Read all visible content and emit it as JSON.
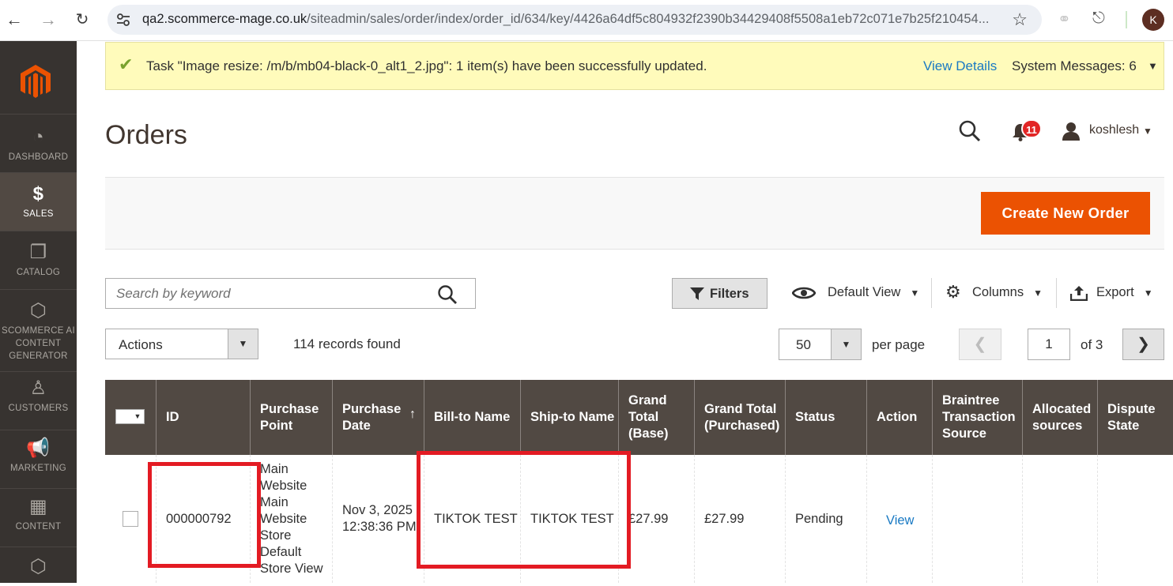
{
  "browser": {
    "url_host": "qa2.scommerce-mage.co.uk",
    "url_path": "/siteadmin/sales/order/index/order_id/634/key/4426a64df5c804932f2390b34429408f5508a1eb72c071e7b25f210454...",
    "profile_initial": "K"
  },
  "sidebar": {
    "items": [
      {
        "label": "DASHBOARD",
        "icon": "dashboard-icon"
      },
      {
        "label": "SALES",
        "icon": "dollar-icon"
      },
      {
        "label": "CATALOG",
        "icon": "box-icon"
      },
      {
        "label": "SCOMMERCE AI CONTENT GENERATOR",
        "icon": "hexagon-icon"
      },
      {
        "label": "CUSTOMERS",
        "icon": "person-icon"
      },
      {
        "label": "MARKETING",
        "icon": "megaphone-icon"
      },
      {
        "label": "CONTENT",
        "icon": "layout-icon"
      },
      {
        "label": "",
        "icon": "hexagon-icon"
      }
    ],
    "active": "SALES"
  },
  "system_message": {
    "text": "Task \"Image resize: /m/b/mb04-black-0_alt1_2.jpg\": 1 item(s) have been successfully updated.",
    "view_details": "View Details",
    "system_messages": "System Messages: 6"
  },
  "header": {
    "title": "Orders",
    "notifications_count": "11",
    "username": "koshlesh"
  },
  "actions": {
    "create_new_order": "Create New Order"
  },
  "toolbar": {
    "search_placeholder": "Search by keyword",
    "filters": "Filters",
    "default_view": "Default View",
    "columns": "Columns",
    "export": "Export",
    "mass_action": "Actions",
    "records_found": "114 records found",
    "per_page_value": "50",
    "per_page_label": "per page",
    "current_page": "1",
    "total_pages": "of 3"
  },
  "grid": {
    "columns": [
      "ID",
      "Purchase Point",
      "Purchase Date",
      "Bill-to Name",
      "Ship-to Name",
      "Grand Total (Base)",
      "Grand Total (Purchased)",
      "Status",
      "Action",
      "Braintree Transaction Source",
      "Allocated sources",
      "Dispute State"
    ],
    "sorted_column": "Purchase Date",
    "rows": [
      {
        "id": "000000792",
        "purchase_point": "Main Website Main Website Store Default Store View",
        "purchase_date": "Nov 3, 2025 12:38:36 PM",
        "bill_to": "TIKTOK TEST",
        "ship_to": "TIKTOK TEST",
        "grand_total_base": "£27.99",
        "grand_total_purchased": "£27.99",
        "status": "Pending",
        "action": "View"
      }
    ]
  },
  "colors": {
    "sidebar_bg": "#373330",
    "accent_orange": "#eb5202",
    "grid_header": "#514943",
    "link_blue": "#1979c3",
    "highlight_red": "#e31b23",
    "message_bg": "#fffbbb"
  }
}
